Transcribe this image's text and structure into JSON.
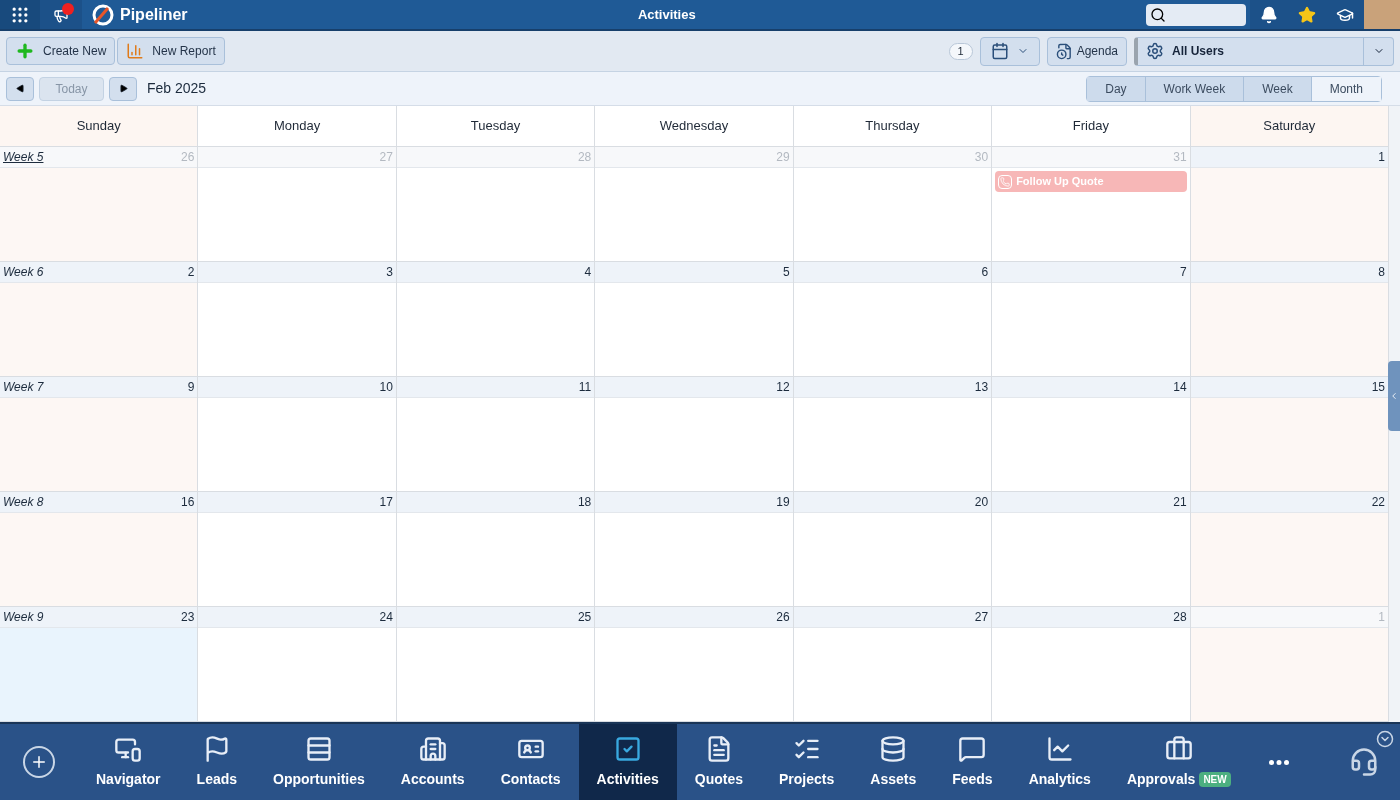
{
  "top_bar": {
    "brand": "Pipeliner",
    "title": "Activities",
    "notification_dot": true
  },
  "toolbar": {
    "buttons": [
      {
        "label": "Create New",
        "kind": "create"
      },
      {
        "label": "New Report",
        "kind": "report"
      }
    ],
    "count": "1",
    "agenda": "Agenda",
    "user_filter": "All Users"
  },
  "nav": {
    "today": "Today",
    "period": "Feb 2025",
    "views": [
      {
        "label": "Day",
        "selected": false
      },
      {
        "label": "Work Week",
        "selected": false
      },
      {
        "label": "Week",
        "selected": false
      },
      {
        "label": "Month",
        "selected": true
      }
    ]
  },
  "day_headers": [
    {
      "label": "Sunday",
      "weekend": true
    },
    {
      "label": "Monday",
      "weekend": false
    },
    {
      "label": "Tuesday",
      "weekend": false
    },
    {
      "label": "Wednesday",
      "weekend": false
    },
    {
      "label": "Thursday",
      "weekend": false
    },
    {
      "label": "Friday",
      "weekend": false
    },
    {
      "label": "Saturday",
      "weekend": true
    }
  ],
  "weeks": [
    {
      "label": "Week 5",
      "hovered": true,
      "days": [
        {
          "number": "26",
          "in_month": false,
          "today": false
        },
        {
          "number": "27",
          "in_month": false,
          "today": false
        },
        {
          "number": "28",
          "in_month": false,
          "today": false
        },
        {
          "number": "29",
          "in_month": false,
          "today": false
        },
        {
          "number": "30",
          "in_month": false,
          "today": false
        },
        {
          "number": "31",
          "in_month": false,
          "today": false,
          "events": [
            {
              "title": "Follow Up Quote",
              "color": "#f7b7b7"
            }
          ]
        },
        {
          "number": "1",
          "in_month": true,
          "today": false
        }
      ]
    },
    {
      "label": "Week 6",
      "hovered": false,
      "days": [
        {
          "number": "2",
          "in_month": true,
          "today": false
        },
        {
          "number": "3",
          "in_month": true,
          "today": false
        },
        {
          "number": "4",
          "in_month": true,
          "today": false
        },
        {
          "number": "5",
          "in_month": true,
          "today": false
        },
        {
          "number": "6",
          "in_month": true,
          "today": false
        },
        {
          "number": "7",
          "in_month": true,
          "today": false
        },
        {
          "number": "8",
          "in_month": true,
          "today": false
        }
      ]
    },
    {
      "label": "Week 7",
      "hovered": false,
      "days": [
        {
          "number": "9",
          "in_month": true,
          "today": false
        },
        {
          "number": "10",
          "in_month": true,
          "today": false
        },
        {
          "number": "11",
          "in_month": true,
          "today": false
        },
        {
          "number": "12",
          "in_month": true,
          "today": false
        },
        {
          "number": "13",
          "in_month": true,
          "today": false
        },
        {
          "number": "14",
          "in_month": true,
          "today": false
        },
        {
          "number": "15",
          "in_month": true,
          "today": false
        }
      ]
    },
    {
      "label": "Week 8",
      "hovered": false,
      "days": [
        {
          "number": "16",
          "in_month": true,
          "today": false
        },
        {
          "number": "17",
          "in_month": true,
          "today": false
        },
        {
          "number": "18",
          "in_month": true,
          "today": false
        },
        {
          "number": "19",
          "in_month": true,
          "today": false
        },
        {
          "number": "20",
          "in_month": true,
          "today": false
        },
        {
          "number": "21",
          "in_month": true,
          "today": false
        },
        {
          "number": "22",
          "in_month": true,
          "today": false
        }
      ]
    },
    {
      "label": "Week 9",
      "hovered": false,
      "days": [
        {
          "number": "23",
          "in_month": true,
          "today": true
        },
        {
          "number": "24",
          "in_month": true,
          "today": false
        },
        {
          "number": "25",
          "in_month": true,
          "today": false
        },
        {
          "number": "26",
          "in_month": true,
          "today": false
        },
        {
          "number": "27",
          "in_month": true,
          "today": false
        },
        {
          "number": "28",
          "in_month": true,
          "today": false
        },
        {
          "number": "1",
          "in_month": false,
          "today": false
        }
      ]
    }
  ],
  "bottom_nav": [
    {
      "label": "Navigator",
      "kind": "navigator",
      "selected": false
    },
    {
      "label": "Leads",
      "kind": "leads",
      "selected": false
    },
    {
      "label": "Opportunities",
      "kind": "opportunities",
      "selected": false
    },
    {
      "label": "Accounts",
      "kind": "accounts",
      "selected": false
    },
    {
      "label": "Contacts",
      "kind": "contacts",
      "selected": false
    },
    {
      "label": "Activities",
      "kind": "activities",
      "selected": true
    },
    {
      "label": "Quotes",
      "kind": "quotes",
      "selected": false
    },
    {
      "label": "Projects",
      "kind": "projects",
      "selected": false
    },
    {
      "label": "Assets",
      "kind": "assets",
      "selected": false
    },
    {
      "label": "Feeds",
      "kind": "feeds",
      "selected": false
    },
    {
      "label": "Analytics",
      "kind": "analytics",
      "selected": false
    },
    {
      "label": "Approvals",
      "kind": "approvals",
      "selected": false,
      "badge": "NEW"
    }
  ]
}
